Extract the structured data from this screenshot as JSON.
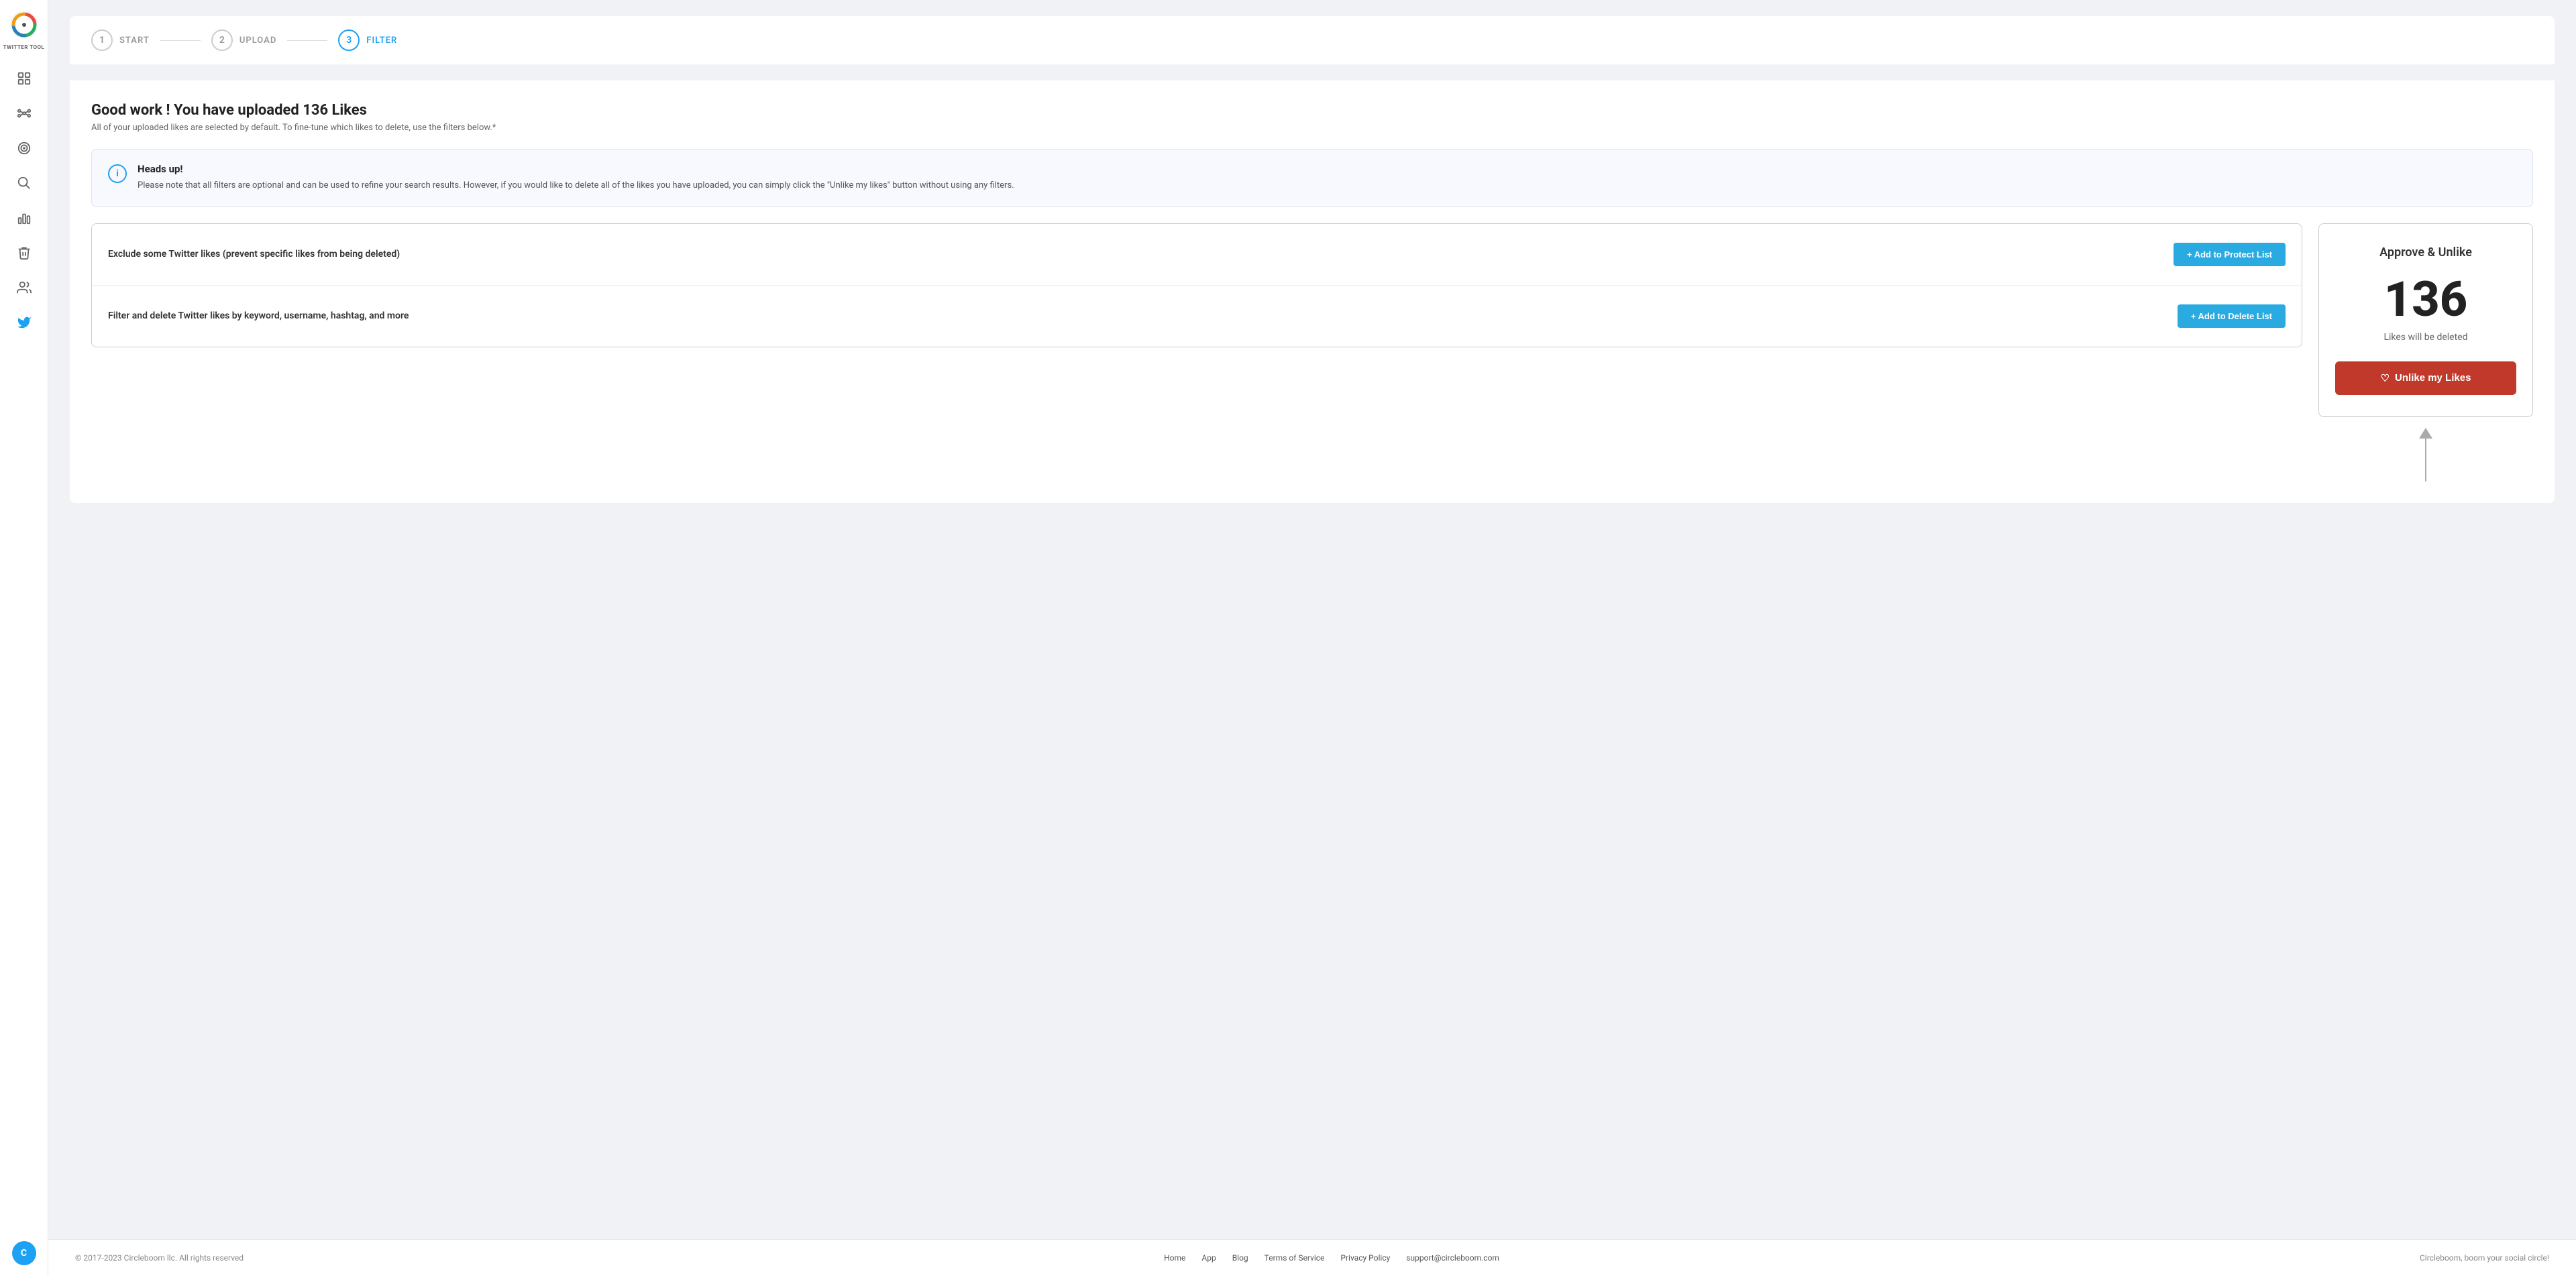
{
  "sidebar": {
    "logo_label": "TWITTER TOOL",
    "items": [
      {
        "name": "dashboard",
        "label": "Dashboard"
      },
      {
        "name": "network",
        "label": "Network"
      },
      {
        "name": "target",
        "label": "Target"
      },
      {
        "name": "search",
        "label": "Search"
      },
      {
        "name": "analytics",
        "label": "Analytics"
      },
      {
        "name": "delete",
        "label": "Delete"
      },
      {
        "name": "users",
        "label": "Users"
      },
      {
        "name": "twitter",
        "label": "Twitter"
      }
    ]
  },
  "stepper": {
    "steps": [
      {
        "number": "1",
        "label": "START",
        "active": false
      },
      {
        "number": "2",
        "label": "UPLOAD",
        "active": false
      },
      {
        "number": "3",
        "label": "FILTER",
        "active": true
      }
    ]
  },
  "page": {
    "title": "Good work ! You have uploaded 136 Likes",
    "subtitle": "All of your uploaded likes are selected by default. To fine-tune which likes to delete, use the filters below.*"
  },
  "alert": {
    "title": "Heads up!",
    "text": "Please note that all filters are optional and can be used to refine your search results. However, if you would like to delete all of the likes you have uploaded, you can simply click the \"Unlike my likes\" button without using any filters."
  },
  "filters": [
    {
      "text": "Exclude some Twitter likes (prevent specific likes from being deleted)",
      "button_label": "+ Add to Protect List"
    },
    {
      "text": "Filter and delete Twitter likes by keyword, username, hashtag, and more",
      "button_label": "+ Add to Delete List"
    }
  ],
  "approve": {
    "title": "Approve & Unlike",
    "count": "136",
    "label": "Likes will be deleted",
    "button_label": "Unlike my Likes"
  },
  "footer": {
    "copyright": "© 2017-2023 Circleboom llc. All rights reserved",
    "links": [
      {
        "label": "Home"
      },
      {
        "label": "App"
      },
      {
        "label": "Blog"
      },
      {
        "label": "Terms of Service"
      },
      {
        "label": "Privacy Policy"
      },
      {
        "label": "support@circleboom.com"
      }
    ],
    "tagline": "Circleboom, boom your social circle!"
  }
}
